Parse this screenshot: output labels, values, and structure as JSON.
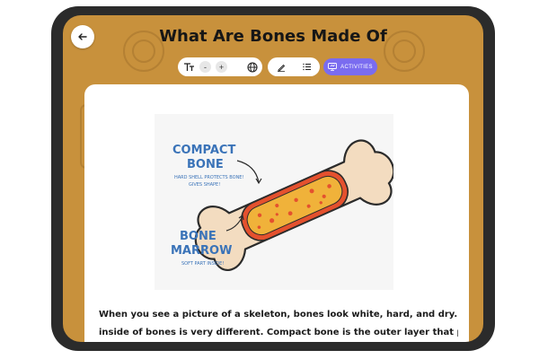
{
  "header": {
    "title": "What Are Bones Made Of"
  },
  "toolbar": {
    "minus_label": "-",
    "plus_label": "+",
    "activities_label": "ACTIVITIES"
  },
  "icons": {
    "back": "arrow-left-icon",
    "text_size": "text-size-icon",
    "language": "globe-icon",
    "highlight": "pen-icon",
    "list": "list-icon",
    "activities": "presentation-icon"
  },
  "illustration": {
    "compact_label": "COMPACT BONE",
    "compact_caption": "HARD SHELL PROTECTS BONE! GIVES SHAPE!",
    "marrow_label": "BONE MARROW",
    "marrow_caption": "SOFT PART INSIDE!"
  },
  "content": {
    "paragraph": "When you see a picture of a skeleton, bones look white, hard, and dry. But the",
    "paragraph_cont": "inside of bones is very different. Compact bone is the outer layer that protects"
  },
  "colors": {
    "background": "#c8913c",
    "accent": "#7a6cf0",
    "label_blue": "#3a73b8",
    "bone": "#f3dcc0",
    "marrow": "#f0b23a"
  }
}
